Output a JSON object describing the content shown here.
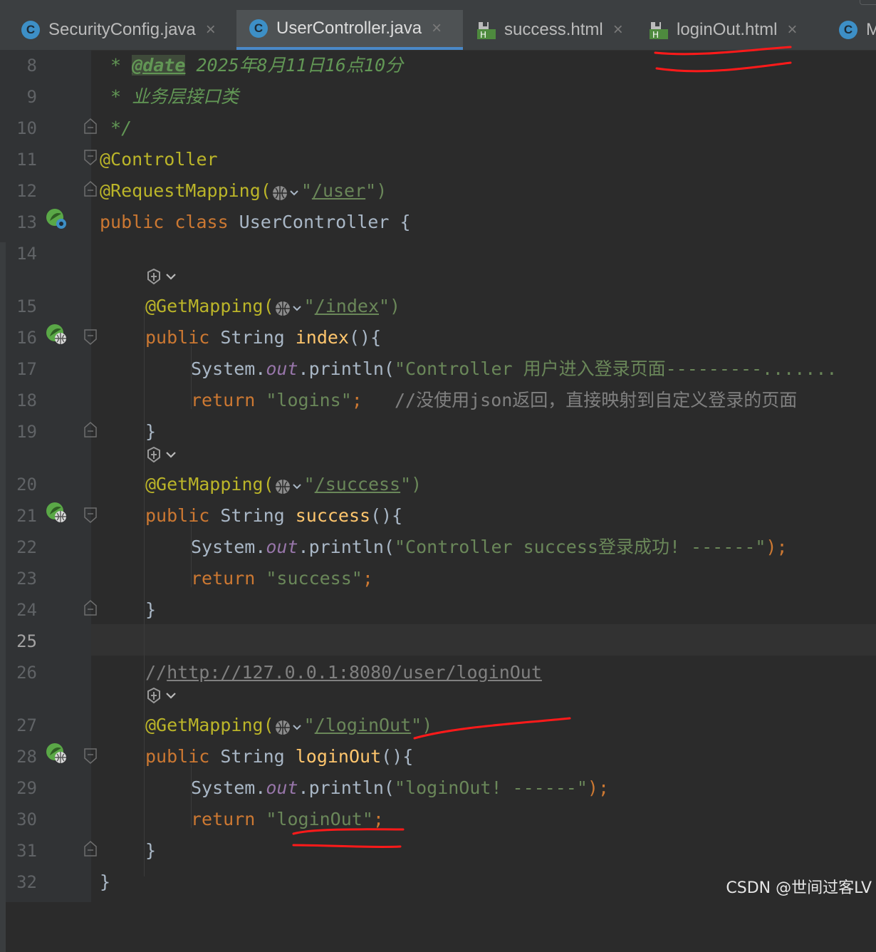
{
  "tabs": [
    {
      "label": "SecurityConfig.java",
      "icon": "java-class-icon",
      "active": false
    },
    {
      "label": "UserController.java",
      "icon": "java-class-icon",
      "active": true
    },
    {
      "label": "success.html",
      "icon": "html-file-icon",
      "active": false
    },
    {
      "label": "loginOut.html",
      "icon": "html-file-icon",
      "active": false
    },
    {
      "label": "M",
      "icon": "java-class-icon",
      "active": false
    }
  ],
  "icon_letters": {
    "class": "C",
    "html": "H"
  },
  "close_glyph": "×",
  "line_numbers": [
    "8",
    "9",
    "10",
    "11",
    "12",
    "13",
    "14",
    "15",
    "16",
    "17",
    "18",
    "19",
    "20",
    "21",
    "22",
    "23",
    "24",
    "25",
    "26",
    "27",
    "28",
    "29",
    "30",
    "31",
    "32"
  ],
  "current_line": "25",
  "code": {
    "l8": {
      "star": " * ",
      "tag": "@date",
      "text": " 2025年8月11日16点10分"
    },
    "l9": " * 业务层接口类",
    "l10": " */",
    "l11": "@Controller",
    "l12": {
      "ann": "@RequestMapping(",
      "open": "\"",
      "path": "/user",
      "close": "\")"
    },
    "l13": {
      "kw": "public class ",
      "name": "UserController {"
    },
    "l15": {
      "ann": "@GetMapping(",
      "open": "\"",
      "path": "/index",
      "close": "\")"
    },
    "l16": {
      "kw": "public ",
      "type": "String ",
      "fn": "index",
      "rest": "(){"
    },
    "l17": {
      "sys": "System.",
      "out": "out",
      "print": ".println(",
      "str": "\"Controller 用户进入登录页面---------......."
    },
    "l18": {
      "kw": "return ",
      "str": "\"logins\"",
      "semi": ";",
      "cmt": "   //没使用json返回，直接映射到自定义登录的页面"
    },
    "l19": "}",
    "l20": {
      "ann": "@GetMapping(",
      "open": "\"",
      "path": "/success",
      "close": "\")"
    },
    "l21": {
      "kw": "public ",
      "type": "String ",
      "fn": "success",
      "rest": "(){"
    },
    "l22": {
      "sys": "System.",
      "out": "out",
      "print": ".println(",
      "str": "\"Controller success登录成功! ------\"",
      "end": ");"
    },
    "l23": {
      "kw": "return ",
      "str": "\"success\"",
      "semi": ";"
    },
    "l24": "}",
    "l26": {
      "cmt": "//",
      "url": "http://127.0.0.1:8080/user/loginOut"
    },
    "l27": {
      "ann": "@GetMapping(",
      "open": "\"",
      "path": "/loginOut",
      "close": "\")"
    },
    "l28": {
      "kw": "public ",
      "type": "String ",
      "fn": "loginOut",
      "rest": "(){"
    },
    "l29": {
      "sys": "System.",
      "out": "out",
      "print": ".println(",
      "str": "\"loginOut! ------\"",
      "end": ");"
    },
    "l30": {
      "kw": "return ",
      "str": "\"loginOut\"",
      "semi": ";"
    },
    "l31": "}",
    "l32": "}"
  },
  "watermark": "CSDN @世间过客LV",
  "colors": {
    "editor_bg": "#2b2b2b",
    "keyword": "#cc7832",
    "annotation": "#bbb529",
    "string": "#6a8759",
    "method": "#ffc66d",
    "annotation_marks": "#ff0000"
  }
}
